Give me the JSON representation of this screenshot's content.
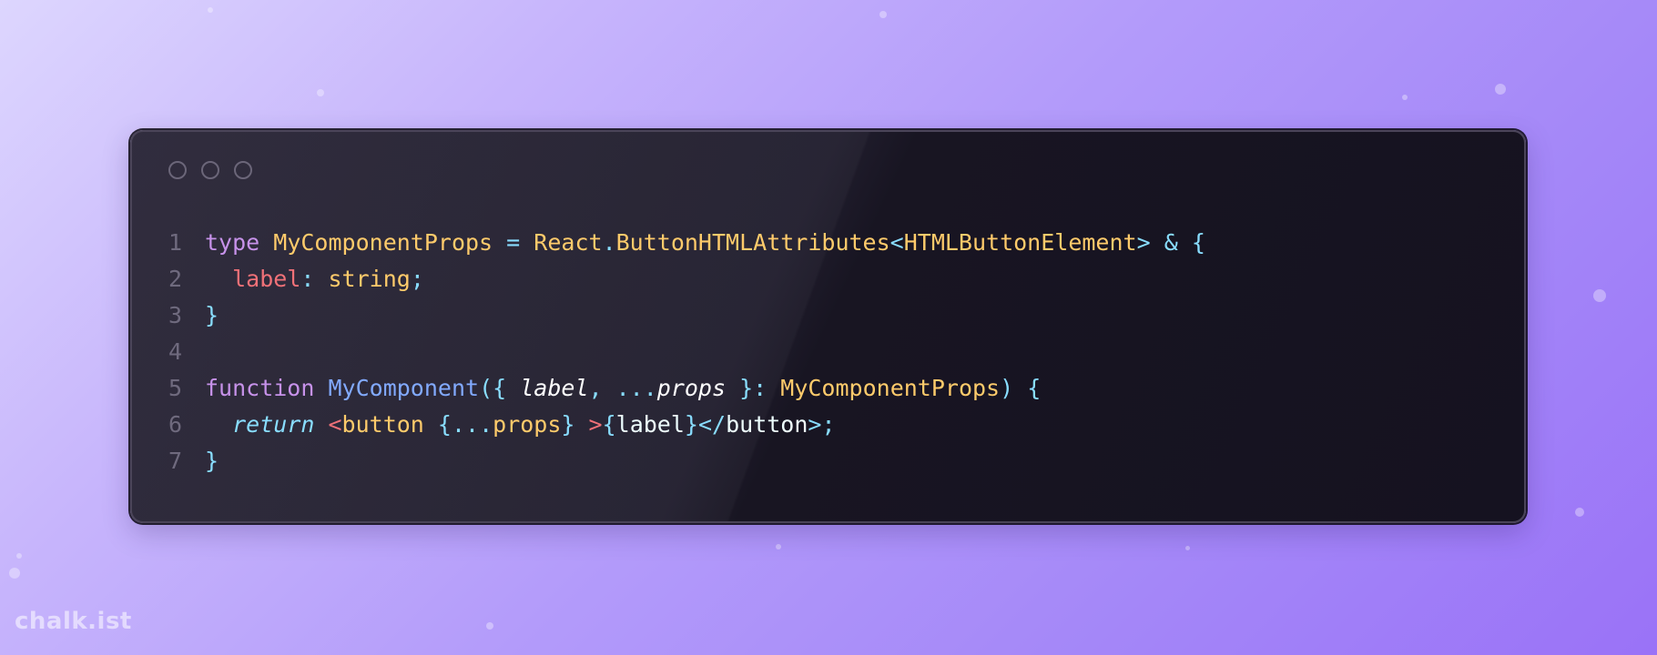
{
  "window": {
    "controls": [
      "window-dot",
      "window-dot",
      "window-dot"
    ]
  },
  "code": {
    "lines": [
      {
        "number": "1",
        "tokens": [
          {
            "t": "type",
            "c": "kw"
          },
          {
            "t": " ",
            "c": "plain"
          },
          {
            "t": "MyComponentProps",
            "c": "type"
          },
          {
            "t": " ",
            "c": "plain"
          },
          {
            "t": "=",
            "c": "punc"
          },
          {
            "t": " ",
            "c": "plain"
          },
          {
            "t": "React",
            "c": "type"
          },
          {
            "t": ".",
            "c": "punc"
          },
          {
            "t": "ButtonHTMLAttributes",
            "c": "type"
          },
          {
            "t": "<",
            "c": "punc"
          },
          {
            "t": "HTMLButtonElement",
            "c": "type"
          },
          {
            "t": ">",
            "c": "punc"
          },
          {
            "t": " ",
            "c": "plain"
          },
          {
            "t": "&",
            "c": "punc"
          },
          {
            "t": " ",
            "c": "plain"
          },
          {
            "t": "{",
            "c": "punc"
          }
        ]
      },
      {
        "number": "2",
        "tokens": [
          {
            "t": "  ",
            "c": "plain"
          },
          {
            "t": "label",
            "c": "prop"
          },
          {
            "t": ":",
            "c": "punc"
          },
          {
            "t": " ",
            "c": "plain"
          },
          {
            "t": "string",
            "c": "type"
          },
          {
            "t": ";",
            "c": "punc"
          }
        ]
      },
      {
        "number": "3",
        "tokens": [
          {
            "t": "}",
            "c": "punc"
          }
        ]
      },
      {
        "number": "4",
        "tokens": []
      },
      {
        "number": "5",
        "tokens": [
          {
            "t": "function",
            "c": "kw"
          },
          {
            "t": " ",
            "c": "plain"
          },
          {
            "t": "MyComponent",
            "c": "fn"
          },
          {
            "t": "({",
            "c": "punc"
          },
          {
            "t": " ",
            "c": "plain"
          },
          {
            "t": "label",
            "c": "param"
          },
          {
            "t": ",",
            "c": "punc"
          },
          {
            "t": " ",
            "c": "plain"
          },
          {
            "t": "...",
            "c": "punc"
          },
          {
            "t": "props",
            "c": "param"
          },
          {
            "t": " ",
            "c": "plain"
          },
          {
            "t": "}:",
            "c": "punc"
          },
          {
            "t": " ",
            "c": "plain"
          },
          {
            "t": "MyComponentProps",
            "c": "type"
          },
          {
            "t": ")",
            "c": "punc"
          },
          {
            "t": " ",
            "c": "plain"
          },
          {
            "t": "{",
            "c": "punc"
          }
        ]
      },
      {
        "number": "6",
        "tokens": [
          {
            "t": "  ",
            "c": "plain"
          },
          {
            "t": "return",
            "c": "ret"
          },
          {
            "t": " ",
            "c": "plain"
          },
          {
            "t": "<",
            "c": "tag"
          },
          {
            "t": "button",
            "c": "type"
          },
          {
            "t": " ",
            "c": "plain"
          },
          {
            "t": "{",
            "c": "punc"
          },
          {
            "t": "...",
            "c": "punc"
          },
          {
            "t": "props",
            "c": "type"
          },
          {
            "t": "}",
            "c": "punc"
          },
          {
            "t": " ",
            "c": "plain"
          },
          {
            "t": ">",
            "c": "tag"
          },
          {
            "t": "{",
            "c": "punc"
          },
          {
            "t": "label",
            "c": "plain"
          },
          {
            "t": "}",
            "c": "punc"
          },
          {
            "t": "</",
            "c": "punc"
          },
          {
            "t": "button",
            "c": "plain"
          },
          {
            "t": ">",
            "c": "punc"
          },
          {
            "t": ";",
            "c": "punc"
          }
        ]
      },
      {
        "number": "7",
        "tokens": [
          {
            "t": "}",
            "c": "punc"
          }
        ]
      }
    ]
  },
  "watermark": {
    "text": "chalk.ist"
  },
  "colors": {
    "keyword": "#c792ea",
    "type": "#ffcb6b",
    "punctuation": "#89ddff",
    "property": "#f07178",
    "function": "#82aaff",
    "line_number": "#6f6a7e"
  }
}
